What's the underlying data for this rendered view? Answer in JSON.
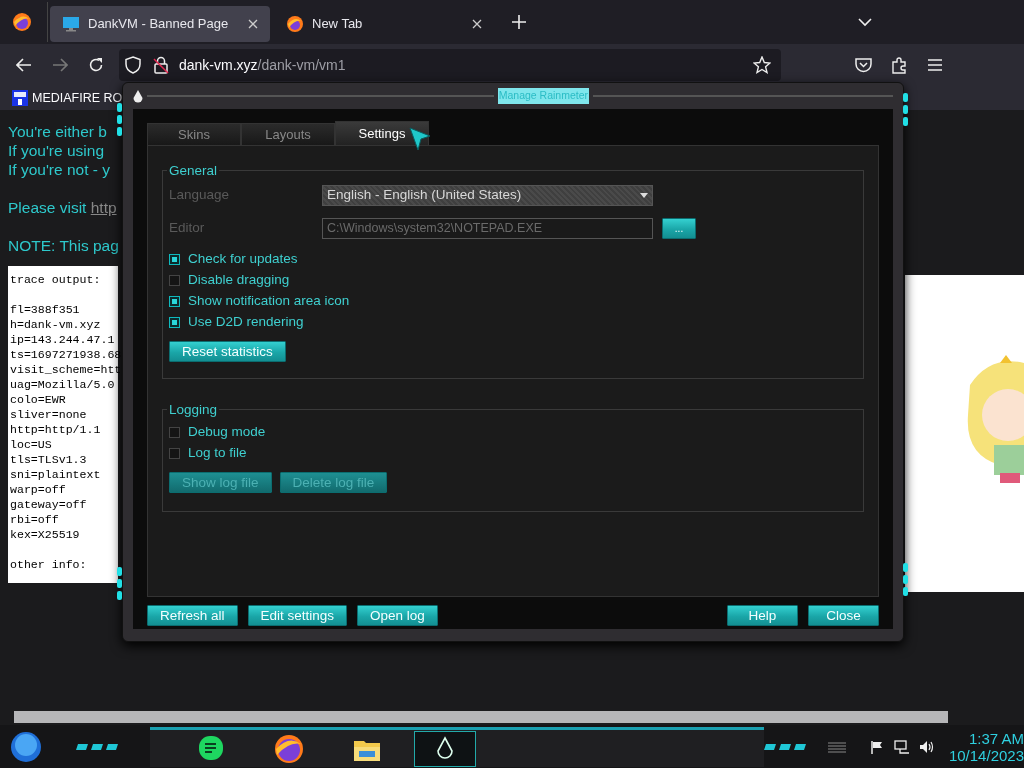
{
  "browser": {
    "tabs": [
      {
        "title": "DankVM - Banned Page",
        "selected": true
      },
      {
        "title": "New Tab",
        "selected": false
      }
    ],
    "url": {
      "host": "dank-vm.xyz",
      "path": "/dank-vm/vm1"
    },
    "bookmarks": [
      {
        "label": "MEDIAFIRE RO"
      }
    ]
  },
  "page": {
    "paragraphs": [
      [
        {
          "text": "You're either b"
        },
        {
          "text": "If you're using"
        },
        {
          "text": "If you're not - y"
        }
      ],
      [
        {
          "text": "Please visit",
          "link": "http"
        }
      ],
      [
        {
          "text": "NOTE: This pag"
        }
      ]
    ],
    "trace": {
      "heading": "trace output:",
      "lines": [
        "fl=388f351",
        "h=dank-vm.xyz",
        "ip=143.244.47.1",
        "ts=1697271938.68",
        "visit_scheme=htt",
        "uag=Mozilla/5.0",
        "colo=EWR",
        "sliver=none",
        "http=http/1.1",
        "loc=US",
        "tls=TLSv1.3",
        "sni=plaintext",
        "warp=off",
        "gateway=off",
        "rbi=off",
        "kex=X25519"
      ],
      "footer": "other info:"
    },
    "side_picture": {
      "kind": "picture"
    }
  },
  "rainmeter": {
    "title": "Manage Rainmeter",
    "tabs": [
      {
        "label": "Skins",
        "selected": false
      },
      {
        "label": "Layouts",
        "selected": false
      },
      {
        "label": "Settings",
        "selected": true
      }
    ],
    "general": {
      "legend": "General",
      "language_label": "Language",
      "language": "English - English (United States)",
      "editor_label": "Editor",
      "editor": "C:\\Windows\\system32\\NOTEPAD.EXE",
      "browse": "...",
      "options": [
        {
          "label": "Check for updates",
          "checked": true
        },
        {
          "label": "Disable dragging",
          "checked": false
        },
        {
          "label": "Show notification area icon",
          "checked": true
        },
        {
          "label": "Use D2D rendering",
          "checked": true
        }
      ],
      "buttons": [
        {
          "label": "Reset statistics",
          "disabled": false
        }
      ]
    },
    "logging": {
      "legend": "Logging",
      "options": [
        {
          "label": "Debug mode",
          "checked": false
        },
        {
          "label": "Log to file",
          "checked": false
        }
      ],
      "buttons": [
        {
          "label": "Show log file",
          "disabled": true
        },
        {
          "label": "Delete log file",
          "disabled": true
        }
      ]
    },
    "footer_left": [
      "Refresh all",
      "Edit settings",
      "Open log"
    ],
    "footer_right": [
      "Help",
      "Close"
    ]
  },
  "taskbar": {
    "apps": [
      {
        "kind": "chat",
        "active": false
      },
      {
        "kind": "firefox",
        "active": false
      },
      {
        "kind": "folder",
        "active": false
      },
      {
        "kind": "drop",
        "active": true
      }
    ],
    "time": "1:37 AM",
    "date": "10/14/2023"
  }
}
